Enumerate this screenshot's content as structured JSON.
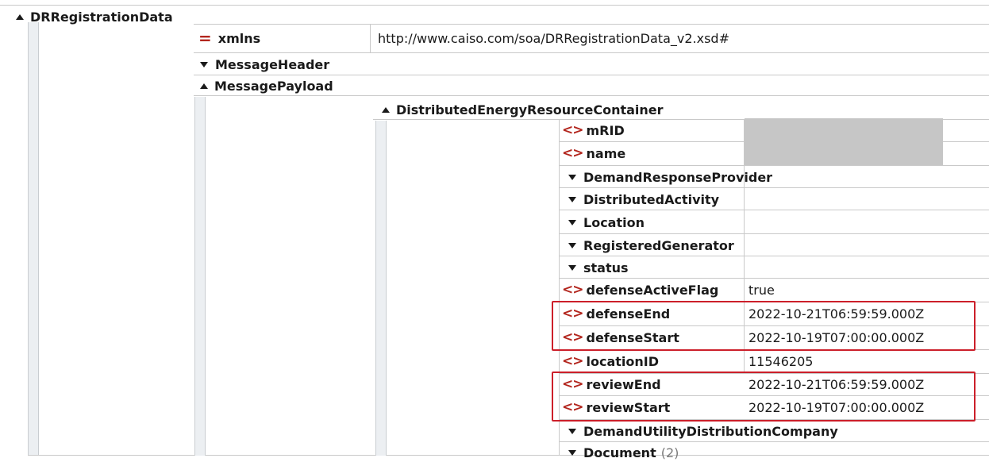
{
  "tree": {
    "root": {
      "label": "DRRegistrationData"
    },
    "xmlns": {
      "label": "xmlns",
      "value": "http://www.caiso.com/soa/DRRegistrationData_v2.xsd#"
    },
    "message_header": {
      "label": "MessageHeader"
    },
    "message_payload": {
      "label": "MessagePayload"
    },
    "container": {
      "label": "DistributedEnergyResourceContainer",
      "children": {
        "mrid": {
          "label": "mRID"
        },
        "name": {
          "label": "name"
        },
        "demand_response_provider": {
          "label": "DemandResponseProvider"
        },
        "distributed_activity": {
          "label": "DistributedActivity"
        },
        "location": {
          "label": "Location"
        },
        "registered_generator": {
          "label": "RegisteredGenerator"
        },
        "status": {
          "label": "status"
        },
        "defense_active_flag": {
          "label": "defenseActiveFlag",
          "value": "true"
        },
        "defense_end": {
          "label": "defenseEnd",
          "value": "2022-10-21T06:59:59.000Z"
        },
        "defense_start": {
          "label": "defenseStart",
          "value": "2022-10-19T07:00:00.000Z"
        },
        "location_id": {
          "label": "locationID",
          "value": "11546205"
        },
        "review_end": {
          "label": "reviewEnd",
          "value": "2022-10-21T06:59:59.000Z"
        },
        "review_start": {
          "label": "reviewStart",
          "value": "2022-10-19T07:00:00.000Z"
        },
        "demand_utility_distribution_company": {
          "label": "DemandUtilityDistributionCompany"
        },
        "document": {
          "label": "Document",
          "count": "(2)"
        }
      }
    }
  },
  "icons": {
    "expanded": "triangle-up-icon",
    "collapsed": "triangle-down-icon",
    "attribute": "equals-icon",
    "element": "angle-brackets-icon"
  },
  "colors": {
    "highlight_box": "#cc1f2a",
    "icon_red": "#b3261e",
    "masked_value": "#c6c6c6"
  }
}
